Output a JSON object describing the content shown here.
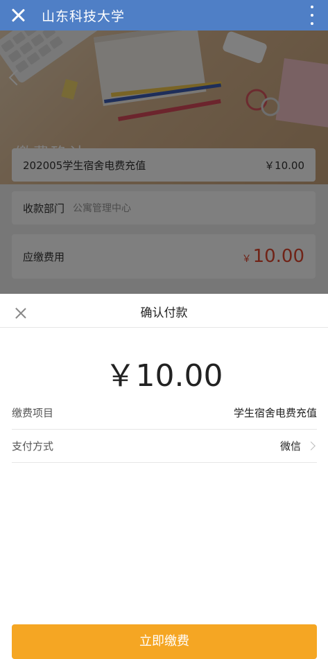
{
  "appbar": {
    "title": "山东科技大学"
  },
  "hero": {
    "page_title": "缴费确认"
  },
  "bill": {
    "item_name": "202005学生宿舍电费充值",
    "item_amount": "￥10.00",
    "dept_label": "收款部门",
    "dept_value": "公寓管理中心",
    "due_label": "应缴费用",
    "due_currency": "￥",
    "due_amount": "10.00"
  },
  "sheet": {
    "title": "确认付款",
    "amount": "￥10.00",
    "item_label": "缴费项目",
    "item_value": "学生宿舍电费充值",
    "method_label": "支付方式",
    "method_value": "微信",
    "pay_button": "立即缴费"
  },
  "colors": {
    "appbar": "#4f7fc6",
    "amount_red": "#e0472f",
    "button_orange": "#f5a623"
  },
  "icons": [
    "close-icon",
    "more-vert-icon",
    "back-icon",
    "chevron-right-icon"
  ]
}
